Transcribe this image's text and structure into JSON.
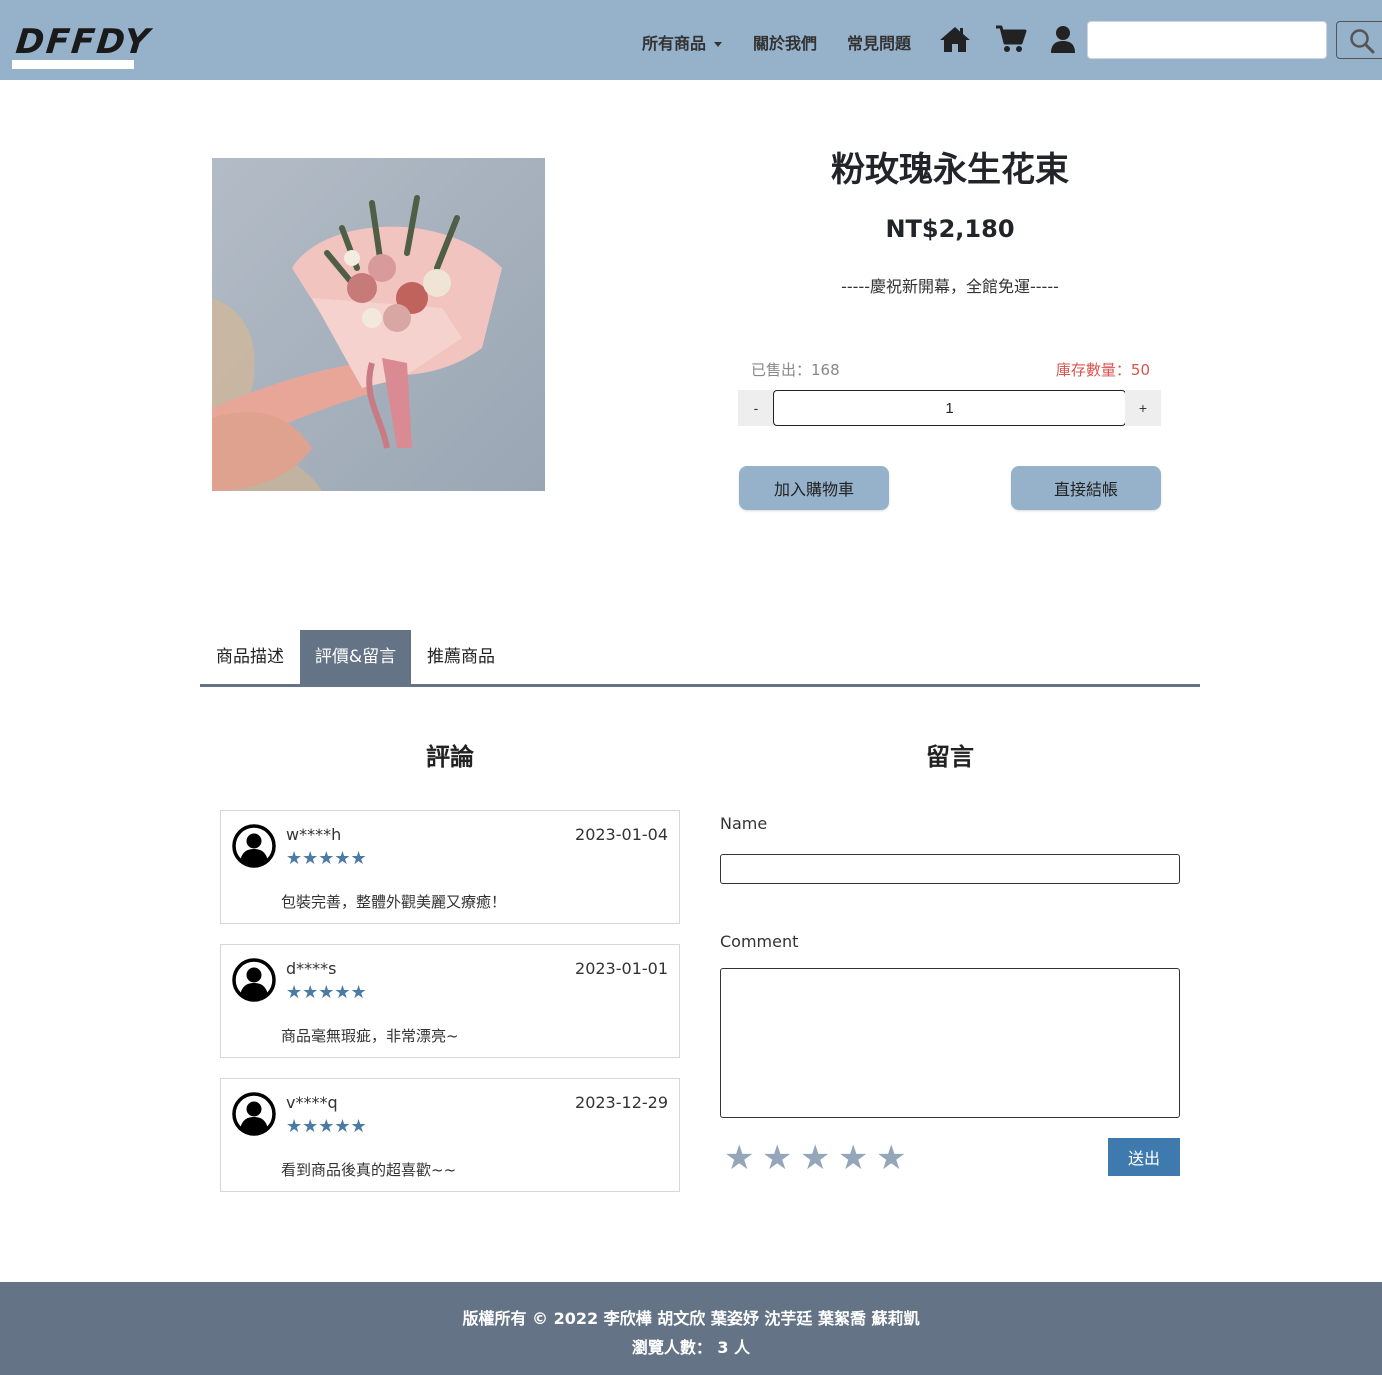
{
  "brand": {
    "logo_text": "DFFDY"
  },
  "nav": {
    "all_products": "所有商品",
    "about": "關於我們",
    "faq": "常見問題",
    "icons": [
      "home-icon",
      "cart-icon",
      "user-icon",
      "search-icon"
    ],
    "search_value": ""
  },
  "product": {
    "title": "粉玫瑰永生花束",
    "price": "NT$2,180",
    "promo": "-----慶祝新開幕，全館免運-----",
    "sold": "已售出：168",
    "stock": "庫存數量：50",
    "qty_minus": "-",
    "qty_plus": "+",
    "quantity": "1",
    "add_to_cart": "加入購物車",
    "checkout": "直接結帳"
  },
  "tabs": [
    {
      "label": "商品描述",
      "active": false
    },
    {
      "label": "評價&留言",
      "active": true
    },
    {
      "label": "推薦商品",
      "active": false
    }
  ],
  "reviews": {
    "heading": "評論",
    "items": [
      {
        "user": "w****h",
        "date": "2023-01-04",
        "stars": "★★★★★",
        "rating": 5,
        "text": "包裝完善，整體外觀美麗又療癒！"
      },
      {
        "user": "d****s",
        "date": "2023-01-01",
        "stars": "★★★★★",
        "rating": 5,
        "text": "商品毫無瑕疵，非常漂亮~"
      },
      {
        "user": "v****q",
        "date": "2023-12-29",
        "stars": "★★★★★",
        "rating": 5,
        "text": "看到商品後真的超喜歡~~"
      }
    ]
  },
  "comment_form": {
    "heading": "留言",
    "name_label": "Name",
    "name_value": "",
    "comment_label": "Comment",
    "comment_value": "",
    "rating_stars": [
      "★",
      "★",
      "★",
      "★",
      "★"
    ],
    "rating": 0,
    "submit": "送出"
  },
  "footer": {
    "copyright": "版權所有 © 2022 李欣樺 胡文欣 葉姿妤 沈芋廷 葉絮喬 蘇莉凱",
    "visitors": "瀏覽人數： 3 人"
  },
  "colors": {
    "navbar": "#96b2cb",
    "accent_dark": "#647386",
    "star_blue": "#4a7ba6",
    "submit_blue": "#3f7aae",
    "stock_red": "#d9534f"
  }
}
